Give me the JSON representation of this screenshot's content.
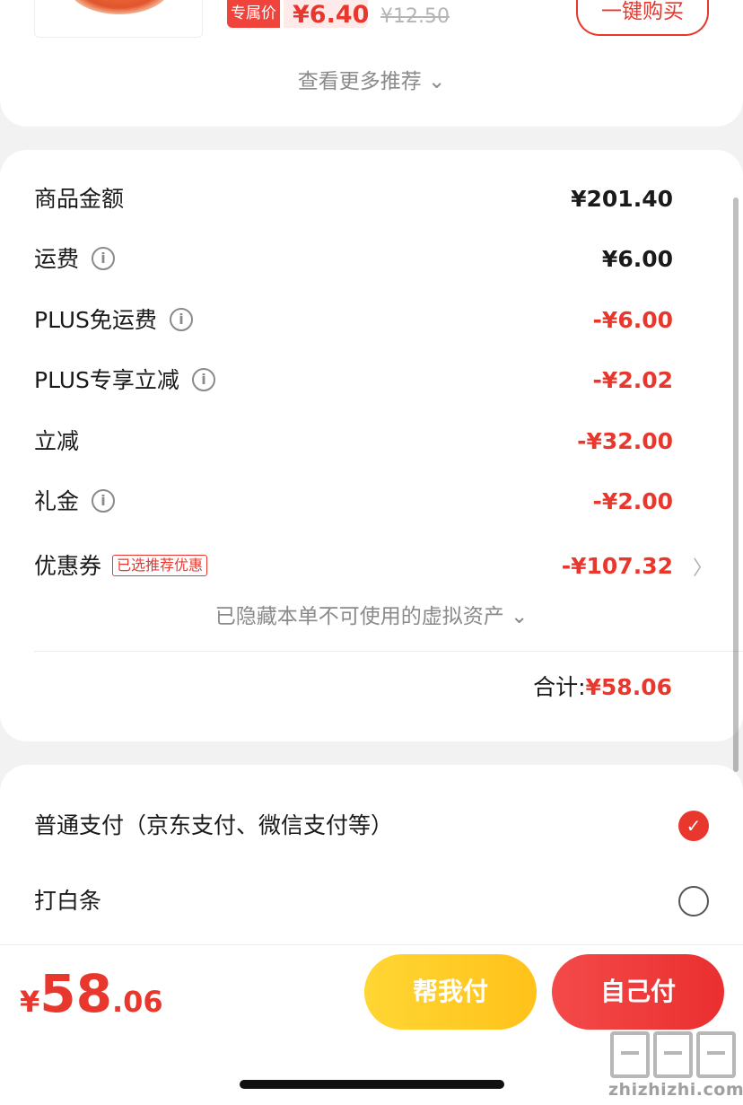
{
  "recommendation": {
    "tag_label": "专属价",
    "price": "¥6.40",
    "original_price": "¥12.50",
    "buy_button": "一键购买",
    "see_more": "查看更多推荐 ⌄"
  },
  "price_detail": {
    "rows": [
      {
        "label": "商品金额",
        "value": "¥201.40"
      },
      {
        "label": "运费",
        "value": "¥6.00"
      },
      {
        "label": "PLUS免运费",
        "value": "-¥6.00"
      },
      {
        "label": "PLUS专享立减",
        "value": "-¥2.02"
      },
      {
        "label": "立减",
        "value": "-¥32.00"
      },
      {
        "label": "礼金",
        "value": "-¥2.00"
      },
      {
        "label": "优惠券",
        "badge": "已选推荐优惠",
        "value": "-¥107.32"
      }
    ],
    "info_glyph": "i",
    "chevron": "〉",
    "hidden_assets": "已隐藏本单不可使用的虚拟资产 ⌄",
    "total_label": "合计:",
    "total_value": "¥58.06"
  },
  "payment": {
    "options": [
      {
        "label": "普通支付（京东支付、微信支付等）",
        "selected": true
      },
      {
        "label": "打白条",
        "selected": false
      }
    ],
    "check_glyph": "✓"
  },
  "bottom_bar": {
    "currency": "¥",
    "amount_int": "58",
    "amount_dec": ".06",
    "help_pay": "帮我付",
    "self_pay": "自己付"
  },
  "watermark": {
    "text": "zhizhizhi.com"
  },
  "colors": {
    "accent_red": "#e8382e",
    "help_yellow": "#ffc21a",
    "background": "#f2f2f2"
  }
}
